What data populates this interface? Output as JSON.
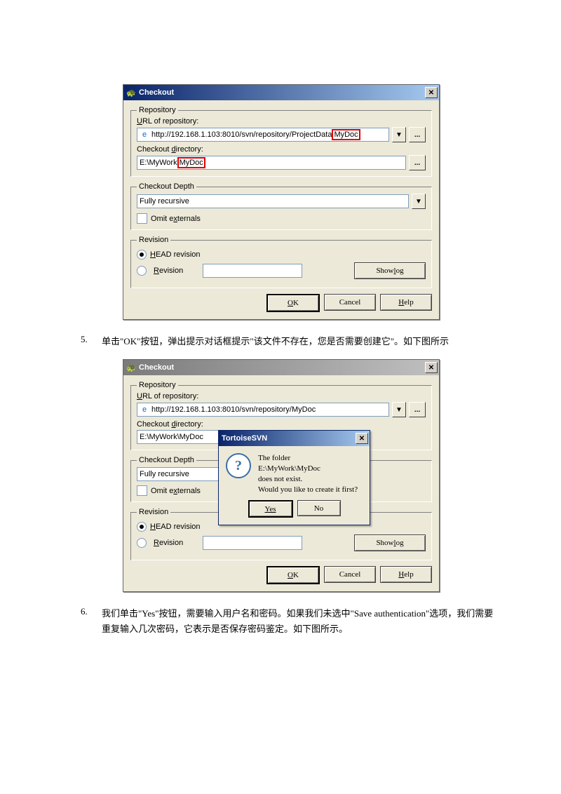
{
  "dialog1": {
    "title": "Checkout",
    "repo_group": "Repository",
    "url_label": "URL of repository:",
    "url_prefix": "http://192.168.1.103:8010/svn/repository/ProjectData",
    "url_highlight": "MyDoc",
    "dir_label": "Checkout directory:",
    "dir_prefix": "E:\\MyWork",
    "dir_highlight": "MyDoc",
    "depth_group": "Checkout Depth",
    "depth_value": "Fully recursive",
    "omit_label": "Omit externals",
    "rev_group": "Revision",
    "head_label": "HEAD revision",
    "rev_label": "Revision",
    "showlog": "Show log",
    "ok": "OK",
    "cancel": "Cancel",
    "help": "Help"
  },
  "step5": {
    "num": "5.",
    "text": "单击\"OK\"按钮，弹出提示对话框提示\"该文件不存在，您是否需要创建它\"。如下图所示"
  },
  "dialog2": {
    "title": "Checkout",
    "url_value": "http://192.168.1.103:8010/svn/repository/MyDoc",
    "dir_value": "E:\\MyWork\\MyDoc"
  },
  "popup": {
    "title": "TortoiseSVN",
    "line1": "The folder",
    "line2": "E:\\MyWork\\MyDoc",
    "line3": "does not exist.",
    "line4": "Would you like to create it first?",
    "yes": "Yes",
    "no": "No"
  },
  "step6": {
    "num": "6.",
    "text": "我们单击\"Yes\"按钮，需要输入用户名和密码。如果我们未选中\"Save authentication\"选项，我们需要重复输入几次密码，它表示是否保存密码鉴定。如下图所示。"
  }
}
